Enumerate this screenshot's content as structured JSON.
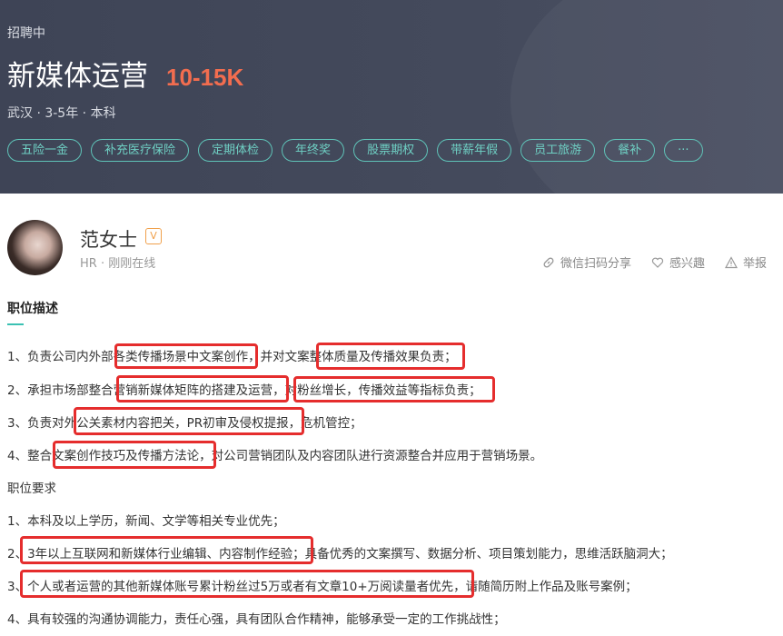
{
  "header": {
    "status": "招聘中",
    "job_title": "新媒体运营",
    "salary": "10-15K",
    "meta": "武汉 · 3-5年 · 本科",
    "tags": [
      "五险一金",
      "补充医疗保险",
      "定期体检",
      "年终奖",
      "股票期权",
      "带薪年假",
      "员工旅游",
      "餐补",
      "···"
    ]
  },
  "recruiter": {
    "name": "范女士",
    "badge": "V",
    "info": "HR · 刚刚在线"
  },
  "actions": {
    "share": "微信扫码分享",
    "interest": "感兴趣",
    "report": "举报"
  },
  "section": {
    "title": "职位描述",
    "lines": [
      "1、负责公司内外部各类传播场景中文案创作，并对文案整体质量及传播效果负责；",
      "2、承担市场部整合营销新媒体矩阵的搭建及运营，对粉丝增长，传播效益等指标负责；",
      "3、负责对外公关素材内容把关，PR初审及侵权提报，危机管控；",
      "4、整合文案创作技巧及传播方法论，对公司营销团队及内容团队进行资源整合并应用于营销场景。",
      "职位要求",
      "1、本科及以上学历，新闻、文学等相关专业优先；",
      "2、3年以上互联网和新媒体行业编辑、内容制作经验；具备优秀的文案撰写、数据分析、项目策划能力，思维活跃脑洞大；",
      "3、个人或者运营的其他新媒体账号累计粉丝过5万或者有文章10+万阅读量者优先，请随简历附上作品及账号案例；",
      "4、具有较强的沟通协调能力，责任心强，具有团队合作精神，能够承受一定的工作挑战性；"
    ]
  },
  "colors": {
    "header_bg": "#434a5b",
    "salary": "#f26d4f",
    "tag": "#5fc3b8",
    "highlight": "#e52d2d"
  }
}
